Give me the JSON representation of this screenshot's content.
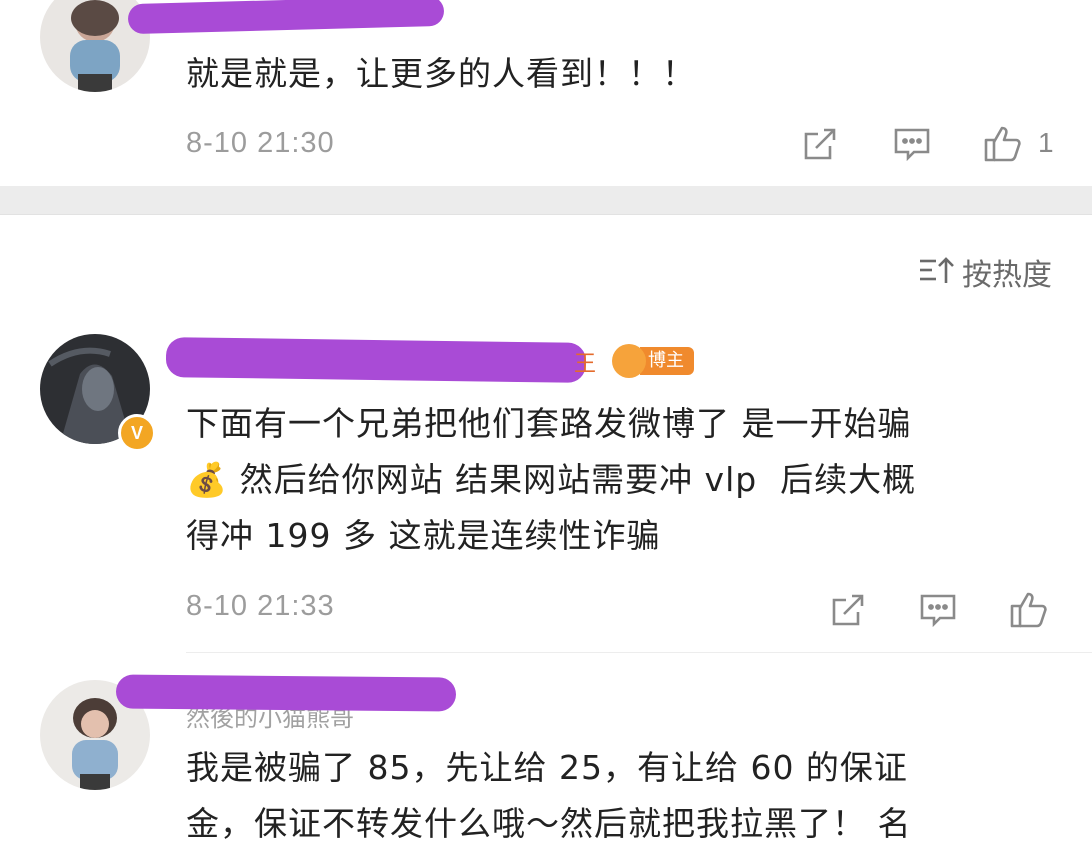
{
  "comments": [
    {
      "text": "就是就是，让更多的人看到！！！",
      "time": "8-10 21:30",
      "likes": "1"
    },
    {
      "text": "下面有一个兄弟把他们套路发微博了 是一开始骗\n💰 然后给你网站 结果网站需要冲 vlp  后续大概\n得冲 199 多 这就是连续性诈骗",
      "time": "8-10 21:33",
      "badge": "博主",
      "name_fragment": "王"
    },
    {
      "text": "我是被骗了 85，先让给 25，有让给 60 的保证\n金，保证不转发什么哦～然后就把我拉黑了！ 名",
      "hidden_name": "然後的小猫熊哥"
    }
  ],
  "sort": {
    "label": "按热度",
    "icon": "sort-icon"
  },
  "colors": {
    "redaction": "#a94bd6",
    "time_gray": "#9c9c9c",
    "divider": "#ececec",
    "badge_orange": "#f08a2d",
    "verified": "#f3a623"
  },
  "icons": [
    "share-icon",
    "comment-icon",
    "like-icon"
  ]
}
